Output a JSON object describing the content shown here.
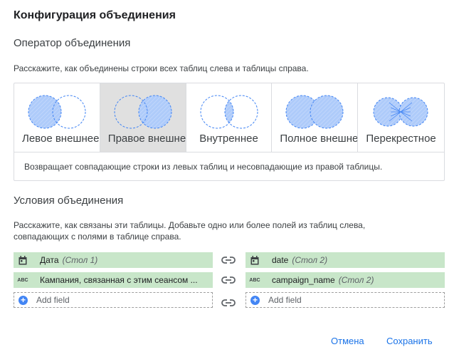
{
  "dialog": {
    "title": "Конфигурация объединения"
  },
  "join_operator": {
    "title": "Оператор объединения",
    "description": "Расскажите, как объединены строки всех таблиц слева и таблицы справа.",
    "types": [
      {
        "label": "Левое внешнее",
        "selected": false,
        "icon": "left-join-icon"
      },
      {
        "label": "Правое внешнее",
        "selected": true,
        "icon": "right-join-icon"
      },
      {
        "label": "Внутреннее",
        "selected": false,
        "icon": "inner-join-icon"
      },
      {
        "label": "Полное внешнее",
        "selected": false,
        "icon": "full-join-icon"
      },
      {
        "label": "Перекрестное",
        "selected": false,
        "icon": "cross-join-icon"
      }
    ],
    "selected_description": "Возвращает совпадающие строки из левых таблиц и несовпадающие из правой таблицы."
  },
  "join_conditions": {
    "title": "Условия объединения",
    "description_line1": "Расскажите, как связаны эти таблицы. Добавьте одно или более полей из таблиц слева,",
    "description_line2": "совпадающих с полями в таблице справа.",
    "rows": [
      {
        "left": {
          "name": "Дата",
          "table": "(Стол 1)",
          "type_icon": "calendar-icon"
        },
        "right": {
          "name": "date",
          "table": "(Стол 2)",
          "type_icon": "calendar-icon"
        }
      },
      {
        "left": {
          "name": "Кампания, связанная с этим сеансом ...",
          "table": "",
          "type_icon": "abc-text-icon",
          "type_text": "ABC"
        },
        "right": {
          "name": "campaign_name",
          "table": "(Стол 2)",
          "type_icon": "abc-text-icon",
          "type_text": "ABC"
        }
      }
    ],
    "add_field_label": "Add field"
  },
  "actions": {
    "cancel": "Отмена",
    "save": "Сохранить"
  },
  "colors": {
    "accent": "#1a73e8",
    "field_bg": "#c8e6c9",
    "venn_fill": "#aecbfa",
    "venn_stroke": "#4285f4",
    "selected_bg": "#e0e0e0"
  }
}
